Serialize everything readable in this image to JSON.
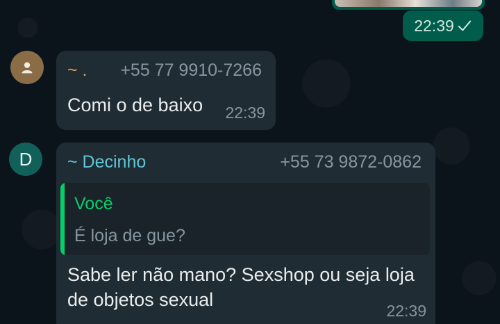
{
  "colors": {
    "background": "#0b141a",
    "incoming_bubble": "#202c33",
    "outgoing_bubble": "#005c4b",
    "quote_accent": "#06cf6a",
    "sender_1": "#d8a35a",
    "sender_2": "#5fc6d6",
    "avatar_1": "#8a6d46",
    "avatar_2": "#12605a"
  },
  "outgoing": {
    "time": "22:39",
    "status_icon": "check-icon"
  },
  "messages": [
    {
      "avatar_icon": "person-icon",
      "sender": "~ .",
      "phone": "+55 77 9910-7266",
      "text": "Comi o de baixo",
      "time": "22:39"
    },
    {
      "avatar_letter": "D",
      "sender": "~ Decinho",
      "phone": "+55 73 9872-0862",
      "quote": {
        "author": "Você",
        "text": "É loja de gue?"
      },
      "text": "Sabe ler não mano? Sexshop ou seja loja de objetos sexual",
      "time": "22:39"
    }
  ]
}
